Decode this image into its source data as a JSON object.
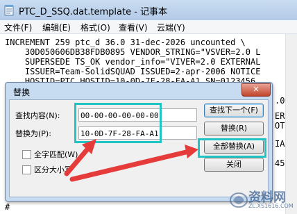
{
  "window": {
    "title": "PTC_D_SSQ.dat.template - 记事本",
    "menu": [
      "文件(F)",
      "编辑(E)",
      "格式(O)",
      "查看(V)",
      "云端(Y)"
    ]
  },
  "editor": {
    "lines": [
      "INCREMENT 259 ptc_d 36.0 31-dec-2026 uncounted \\",
      "    30D050606DB38FDB0895 VENDOR_STRING=\"VSVER=2.0 L",
      "    SUPERSEDE TS_OK vendor_info=\"VIVER=2.0 EXTERNAL",
      "    ISSUER=Team-SolidSQUAD ISSUED=2-apr-2006 NOTICE",
      "    HOSTID=PTC_HOSTID=10-0D-7F-28-FA-A1 SN=0123456",
      "#"
    ],
    "right_fragments": [
      ".0 L",
      "ERNAL",
      "OTICE",
      "IAL\\",
      "456"
    ]
  },
  "dialog": {
    "title": "替换",
    "close_label": "✕",
    "find_label": "查找内容(N):",
    "find_value": "00-00-00-00-00-00",
    "replace_label": "替换为(P):",
    "replace_value": "10-0D-7F-28-FA-A1",
    "find_next_button": "查找下一个(F)",
    "replace_button": "替换(R)",
    "replace_all_button": "全部替换(A)",
    "cancel_button": "关闭",
    "match_word_label": "全字匹配(W)",
    "match_case_label": "区分大小写"
  },
  "watermark": {
    "text": "资料网",
    "url": "ZL.XS1616.COM"
  },
  "colors": {
    "highlight": "#22c3c3",
    "arrow": "#e63b3b"
  }
}
